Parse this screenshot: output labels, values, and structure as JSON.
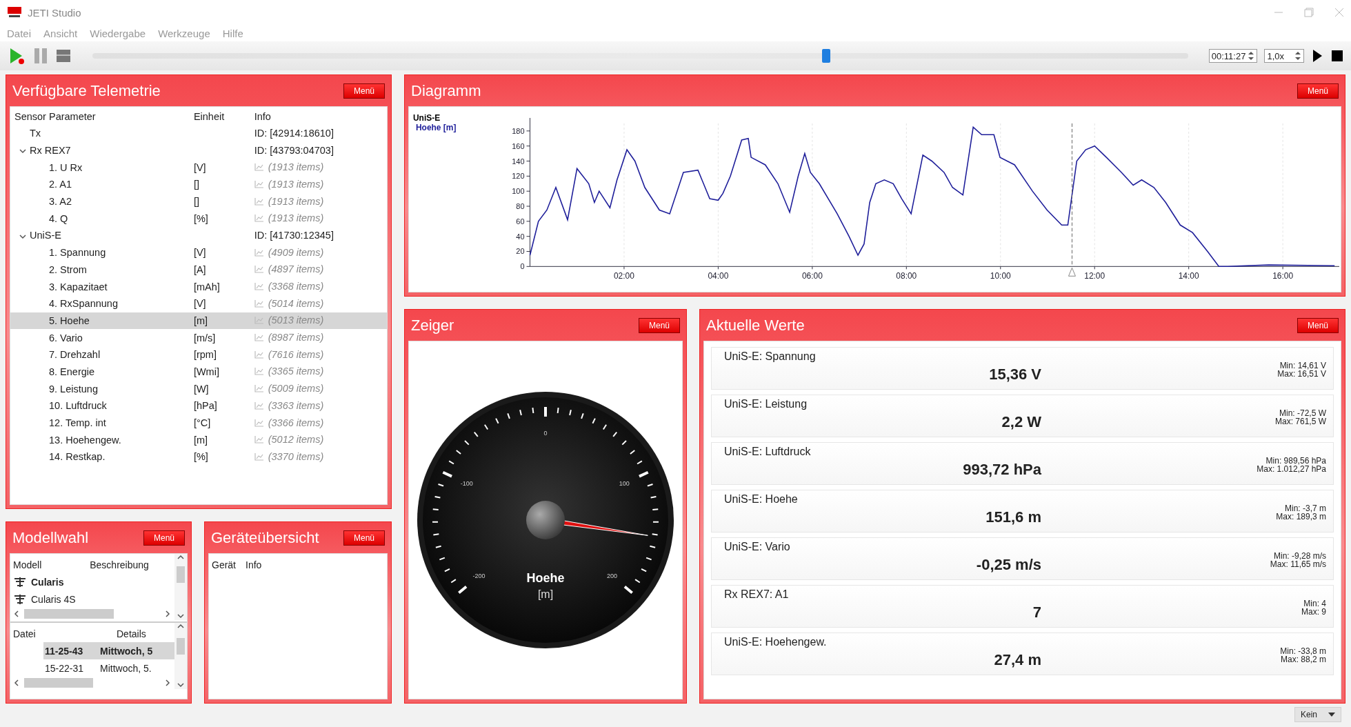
{
  "window": {
    "title": "JETI Studio"
  },
  "menu": [
    "Datei",
    "Ansicht",
    "Wiedergabe",
    "Werkzeuge",
    "Hilfe"
  ],
  "toolbar": {
    "position": {
      "level": 0.67
    },
    "time": "00:11:27",
    "speed": "1,0x"
  },
  "telemetry": {
    "title": "Verfügbare Telemetrie",
    "menu_button": "Menü",
    "columns": [
      "Sensor Parameter",
      "Einheit",
      "Info"
    ],
    "tree": [
      {
        "kind": "device",
        "label": "Tx",
        "info": "ID: [42914:18610]",
        "selected": false
      },
      {
        "kind": "device",
        "label": "Rx REX7",
        "info": "ID: [43793:04703]",
        "selected": false,
        "expanded": true,
        "children": [
          {
            "kind": "sensor",
            "label": "1. U Rx",
            "unit": "[V]",
            "info": "(1913 items)",
            "selected": false
          },
          {
            "kind": "sensor",
            "label": "2. A1",
            "unit": "[]",
            "info": "(1913 items)",
            "selected": false
          },
          {
            "kind": "sensor",
            "label": "3. A2",
            "unit": "[]",
            "info": "(1913 items)",
            "selected": false
          },
          {
            "kind": "sensor",
            "label": "4. Q",
            "unit": "[%]",
            "info": "(1913 items)",
            "selected": false
          }
        ]
      },
      {
        "kind": "device",
        "label": "UniS-E",
        "info": "ID: [41730:12345]",
        "selected": false,
        "expanded": true,
        "children": [
          {
            "kind": "sensor",
            "label": "1. Spannung",
            "unit": "[V]",
            "info": "(4909 items)",
            "selected": false
          },
          {
            "kind": "sensor",
            "label": "2. Strom",
            "unit": "[A]",
            "info": "(4897 items)",
            "selected": false
          },
          {
            "kind": "sensor",
            "label": "3. Kapazitaet",
            "unit": "[mAh]",
            "info": "(3368 items)",
            "selected": false
          },
          {
            "kind": "sensor",
            "label": "4. RxSpannung",
            "unit": "[V]",
            "info": "(5014 items)",
            "selected": false
          },
          {
            "kind": "sensor",
            "label": "5. Hoehe",
            "unit": "[m]",
            "info": "(5013 items)",
            "selected": true
          },
          {
            "kind": "sensor",
            "label": "6. Vario",
            "unit": "[m/s]",
            "info": "(8987 items)",
            "selected": false
          },
          {
            "kind": "sensor",
            "label": "7. Drehzahl",
            "unit": "[rpm]",
            "info": "(7616 items)",
            "selected": false
          },
          {
            "kind": "sensor",
            "label": "8. Energie",
            "unit": "[Wmi]",
            "info": "(3365 items)",
            "selected": false
          },
          {
            "kind": "sensor",
            "label": "9. Leistung",
            "unit": "[W]",
            "info": "(5009 items)",
            "selected": false
          },
          {
            "kind": "sensor",
            "label": "10. Luftdruck",
            "unit": "[hPa]",
            "info": "(3363 items)",
            "selected": false
          },
          {
            "kind": "sensor",
            "label": "12. Temp. int",
            "unit": "[°C]",
            "info": "(3366 items)",
            "selected": false
          },
          {
            "kind": "sensor",
            "label": "13. Hoehengew.",
            "unit": "[m]",
            "info": "(5012 items)",
            "selected": false
          },
          {
            "kind": "sensor",
            "label": "14. Restkap.",
            "unit": "[%]",
            "info": "(3370 items)",
            "selected": false
          }
        ]
      }
    ]
  },
  "diagram": {
    "title": "Diagramm",
    "menu_button": "Menü",
    "chart_data": {
      "type": "line",
      "title": "UniS-E",
      "x": [
        0,
        0.18,
        0.36,
        0.55,
        0.8,
        1.0,
        1.25,
        1.37,
        1.47,
        1.7,
        1.85,
        2.06,
        2.23,
        2.44,
        2.75,
        2.97,
        3.26,
        3.57,
        3.82,
        4.0,
        4.1,
        4.26,
        4.5,
        4.64,
        4.7,
        5.0,
        5.27,
        5.52,
        5.7,
        5.84,
        5.96,
        6.15,
        6.53,
        6.78,
        6.97,
        7.1,
        7.22,
        7.35,
        7.53,
        7.72,
        7.9,
        8.1,
        8.35,
        8.54,
        8.8,
        8.98,
        9.2,
        9.42,
        9.6,
        9.86,
        9.99,
        10.3,
        10.68,
        10.99,
        11.3,
        11.43,
        11.62,
        11.81,
        12.0,
        12.25,
        12.57,
        12.82,
        13.0,
        13.26,
        13.51,
        13.82,
        14.08,
        14.4,
        14.64,
        14.83,
        15.7,
        17.1
      ],
      "series": [
        {
          "name": "Hoehe [m]",
          "color": "#1f1f9a",
          "values": [
            15,
            60,
            75,
            105,
            62,
            130,
            110,
            85,
            100,
            78,
            115,
            155,
            140,
            105,
            75,
            70,
            125,
            128,
            90,
            88,
            97,
            120,
            168,
            170,
            145,
            135,
            110,
            72,
            120,
            150,
            125,
            110,
            70,
            40,
            15,
            30,
            85,
            110,
            115,
            110,
            90,
            70,
            148,
            140,
            125,
            105,
            95,
            185,
            175,
            175,
            145,
            135,
            100,
            75,
            55,
            55,
            140,
            155,
            160,
            145,
            125,
            108,
            115,
            105,
            85,
            55,
            45,
            20,
            0,
            0,
            2,
            1
          ]
        }
      ],
      "xlim": [
        0,
        17.2
      ],
      "ylim": [
        0,
        190
      ],
      "xticks": [
        {
          "value": 2,
          "label": "02:00"
        },
        {
          "value": 4,
          "label": "04:00"
        },
        {
          "value": 6,
          "label": "06:00"
        },
        {
          "value": 8,
          "label": "08:00"
        },
        {
          "value": 10,
          "label": "10:00"
        },
        {
          "value": 12,
          "label": "12:00"
        },
        {
          "value": 14,
          "label": "14:00"
        },
        {
          "value": 16,
          "label": "16:00"
        }
      ],
      "yticks": [
        0,
        20,
        40,
        60,
        80,
        100,
        120,
        140,
        160,
        180
      ],
      "grid": true,
      "ref_lines": [
        {
          "axis": "x",
          "value": 11.52
        }
      ]
    }
  },
  "gauge": {
    "title": "Zeiger",
    "menu_button": "Menü",
    "name": "Hoehe",
    "unit": "[m]",
    "scale_labels": [
      "-200",
      "-100",
      "0",
      "100",
      "200"
    ]
  },
  "values": {
    "title": "Aktuelle Werte",
    "menu_button": "Menü",
    "items": [
      {
        "name": "UniS-E: Spannung",
        "value": "15,36 V",
        "min": "Min: 14,61 V",
        "max": "Max: 16,51 V"
      },
      {
        "name": "UniS-E: Leistung",
        "value": "2,2 W",
        "min": "Min: -72,5 W",
        "max": "Max: 761,5 W"
      },
      {
        "name": "UniS-E: Luftdruck",
        "value": "993,72 hPa",
        "min": "Min: 989,56 hPa",
        "max": "Max: 1.012,27 hPa"
      },
      {
        "name": "UniS-E: Hoehe",
        "value": "151,6 m",
        "min": "Min: -3,7 m",
        "max": "Max: 189,3 m"
      },
      {
        "name": "UniS-E: Vario",
        "value": "-0,25 m/s",
        "min": "Min: -9,28 m/s",
        "max": "Max: 11,65 m/s"
      },
      {
        "name": "Rx REX7: A1",
        "value": "7",
        "min": "Min: 4",
        "max": "Max: 9"
      },
      {
        "name": "UniS-E: Hoehengew.",
        "value": "27,4 m",
        "min": "Min: -33,8 m",
        "max": "Max: 88,2 m"
      }
    ]
  },
  "models": {
    "title": "Modellwahl",
    "menu_button": "Menü",
    "columns": [
      "Modell",
      "Beschreibung"
    ],
    "items": [
      {
        "name": "Cularis",
        "selected": true
      },
      {
        "name": "Cularis 4S",
        "selected": false
      }
    ],
    "file_columns": [
      "Datei",
      "Details"
    ],
    "files": [
      {
        "name": "11-25-43",
        "details": "Mittwoch, 5",
        "selected": true
      },
      {
        "name": "15-22-31",
        "details": "Mittwoch, 5.",
        "selected": false
      }
    ]
  },
  "devices": {
    "title": "Geräteübersicht",
    "menu_button": "Menü",
    "columns": [
      "Gerät",
      "Info"
    ]
  },
  "status_bar": {
    "filter": "Kein"
  }
}
